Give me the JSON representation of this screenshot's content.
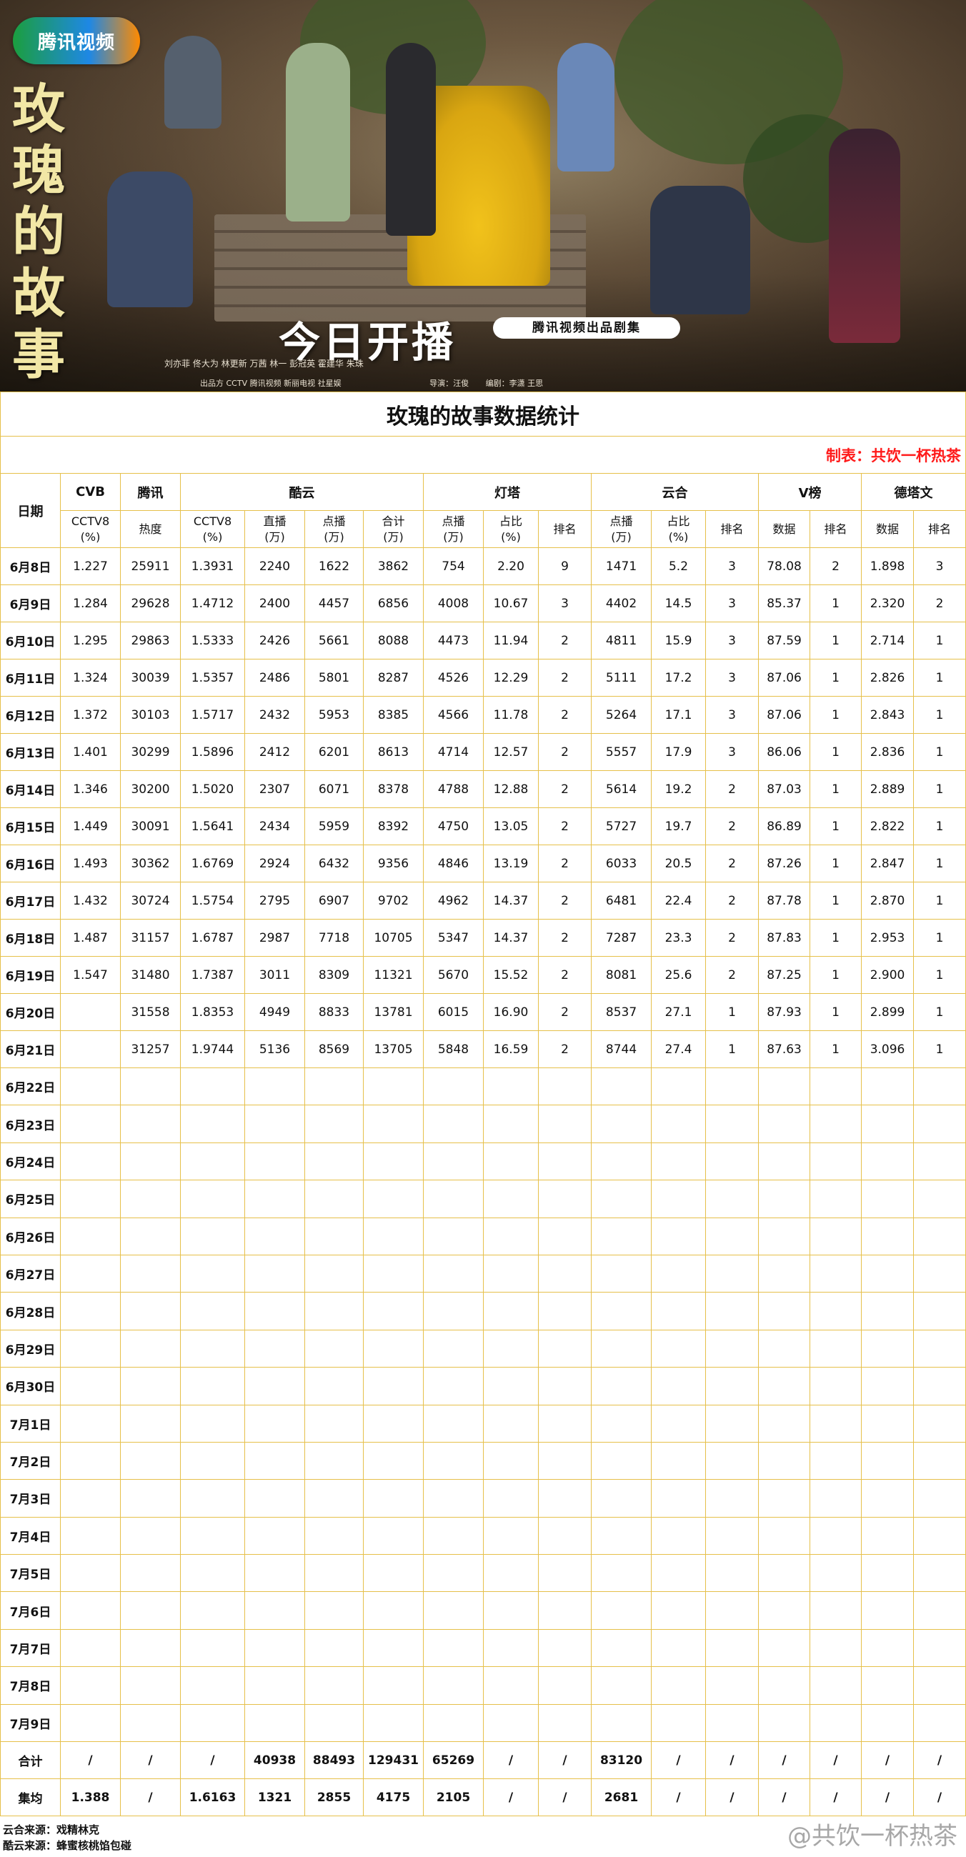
{
  "banner": {
    "logo_text": "腾讯视频",
    "show_title": [
      "玫",
      "瑰",
      "的",
      "故",
      "事"
    ],
    "premiere_text": "今日开播",
    "tag_text": "腾讯视频出品剧集",
    "credits": "刘亦菲   佟大为   林更新   万茜   林一   彭冠英   霍建华   朱珠",
    "producers": "出品方  CCTV  腾讯视频  新丽电视  社星娱",
    "director": "导演：汪俊",
    "writer": "编剧：李潇 王思"
  },
  "title": "玫瑰的故事数据统计",
  "author": "制表：共饮一杯热茶",
  "headers": {
    "date": "日期",
    "groups": [
      {
        "name": "CVB",
        "span": 1
      },
      {
        "name": "腾讯",
        "span": 1
      },
      {
        "name": "酷云",
        "span": 4
      },
      {
        "name": "灯塔",
        "span": 3
      },
      {
        "name": "云合",
        "span": 3
      },
      {
        "name": "V榜",
        "span": 2
      },
      {
        "name": "德塔文",
        "span": 2
      }
    ],
    "subs": [
      [
        "CCTV8",
        "(%)"
      ],
      [
        "热度"
      ],
      [
        "CCTV8",
        "(%)"
      ],
      [
        "直播",
        "(万)"
      ],
      [
        "点播",
        "(万)"
      ],
      [
        "合计",
        "(万)"
      ],
      [
        "点播",
        "(万)"
      ],
      [
        "占比",
        "(%)"
      ],
      [
        "排名"
      ],
      [
        "点播",
        "(万)"
      ],
      [
        "占比",
        "(%)"
      ],
      [
        "排名"
      ],
      [
        "数据"
      ],
      [
        "排名"
      ],
      [
        "数据"
      ],
      [
        "排名"
      ]
    ]
  },
  "rows": [
    {
      "date": "6月8日",
      "cells": [
        "1.227",
        "25911",
        "1.3931",
        "2240",
        "1622",
        "3862",
        "754",
        "2.20",
        "9",
        "1471",
        "5.2",
        "3",
        "78.08",
        "2",
        "1.898",
        "3"
      ]
    },
    {
      "date": "6月9日",
      "cells": [
        "1.284",
        "29628",
        "1.4712",
        "2400",
        "4457",
        "6856",
        "4008",
        "10.67",
        "3",
        "4402",
        "14.5",
        "3",
        "85.37",
        "1",
        "2.320",
        "2"
      ]
    },
    {
      "date": "6月10日",
      "cells": [
        "1.295",
        "29863",
        "1.5333",
        "2426",
        "5661",
        "8088",
        "4473",
        "11.94",
        "2",
        "4811",
        "15.9",
        "3",
        "87.59",
        "1",
        "2.714",
        "1"
      ]
    },
    {
      "date": "6月11日",
      "cells": [
        "1.324",
        "30039",
        "1.5357",
        "2486",
        "5801",
        "8287",
        "4526",
        "12.29",
        "2",
        "5111",
        "17.2",
        "3",
        "87.06",
        "1",
        "2.826",
        "1"
      ]
    },
    {
      "date": "6月12日",
      "cells": [
        "1.372",
        "30103",
        "1.5717",
        "2432",
        "5953",
        "8385",
        "4566",
        "11.78",
        "2",
        "5264",
        "17.1",
        "3",
        "87.06",
        "1",
        "2.843",
        "1"
      ]
    },
    {
      "date": "6月13日",
      "cells": [
        "1.401",
        "30299",
        "1.5896",
        "2412",
        "6201",
        "8613",
        "4714",
        "12.57",
        "2",
        "5557",
        "17.9",
        "3",
        "86.06",
        "1",
        "2.836",
        "1"
      ]
    },
    {
      "date": "6月14日",
      "cells": [
        "1.346",
        "30200",
        "1.5020",
        "2307",
        "6071",
        "8378",
        "4788",
        "12.88",
        "2",
        "5614",
        "19.2",
        "2",
        "87.03",
        "1",
        "2.889",
        "1"
      ]
    },
    {
      "date": "6月15日",
      "cells": [
        "1.449",
        "30091",
        "1.5641",
        "2434",
        "5959",
        "8392",
        "4750",
        "13.05",
        "2",
        "5727",
        "19.7",
        "2",
        "86.89",
        "1",
        "2.822",
        "1"
      ]
    },
    {
      "date": "6月16日",
      "cells": [
        "1.493",
        "30362",
        "1.6769",
        "2924",
        "6432",
        "9356",
        "4846",
        "13.19",
        "2",
        "6033",
        "20.5",
        "2",
        "87.26",
        "1",
        "2.847",
        "1"
      ]
    },
    {
      "date": "6月17日",
      "cells": [
        "1.432",
        "30724",
        "1.5754",
        "2795",
        "6907",
        "9702",
        "4962",
        "14.37",
        "2",
        "6481",
        "22.4",
        "2",
        "87.78",
        "1",
        "2.870",
        "1"
      ]
    },
    {
      "date": "6月18日",
      "cells": [
        "1.487",
        "31157",
        "1.6787",
        "2987",
        "7718",
        "10705",
        "5347",
        "14.37",
        "2",
        "7287",
        "23.3",
        "2",
        "87.83",
        "1",
        "2.953",
        "1"
      ]
    },
    {
      "date": "6月19日",
      "cells": [
        "1.547",
        "31480",
        "1.7387",
        "3011",
        "8309",
        "11321",
        "5670",
        "15.52",
        "2",
        "8081",
        "25.6",
        "2",
        "87.25",
        "1",
        "2.900",
        "1"
      ]
    },
    {
      "date": "6月20日",
      "cells": [
        "",
        "31558",
        "1.8353",
        "4949",
        "8833",
        "13781",
        "6015",
        "16.90",
        "2",
        "8537",
        "27.1",
        "1",
        "87.93",
        "1",
        "2.899",
        "1"
      ]
    },
    {
      "date": "6月21日",
      "cells": [
        "",
        "31257",
        "1.9744",
        "5136",
        "8569",
        "13705",
        "5848",
        "16.59",
        "2",
        "8744",
        "27.4",
        "1",
        "87.63",
        "1",
        "3.096",
        "1"
      ]
    },
    {
      "date": "6月22日",
      "cells": []
    },
    {
      "date": "6月23日",
      "cells": []
    },
    {
      "date": "6月24日",
      "cells": []
    },
    {
      "date": "6月25日",
      "cells": []
    },
    {
      "date": "6月26日",
      "cells": []
    },
    {
      "date": "6月27日",
      "cells": []
    },
    {
      "date": "6月28日",
      "cells": []
    },
    {
      "date": "6月29日",
      "cells": []
    },
    {
      "date": "6月30日",
      "cells": []
    },
    {
      "date": "7月1日",
      "cells": []
    },
    {
      "date": "7月2日",
      "cells": []
    },
    {
      "date": "7月3日",
      "cells": []
    },
    {
      "date": "7月4日",
      "cells": []
    },
    {
      "date": "7月5日",
      "cells": []
    },
    {
      "date": "7月6日",
      "cells": []
    },
    {
      "date": "7月7日",
      "cells": []
    },
    {
      "date": "7月8日",
      "cells": []
    },
    {
      "date": "7月9日",
      "cells": []
    }
  ],
  "summary": [
    {
      "label": "合计",
      "cells": [
        "/",
        "/",
        "/",
        "40938",
        "88493",
        "129431",
        "65269",
        "/",
        "/",
        "83120",
        "/",
        "/",
        "/",
        "/",
        "/",
        "/"
      ]
    },
    {
      "label": "集均",
      "cells": [
        "1.388",
        "/",
        "1.6163",
        "1321",
        "2855",
        "4175",
        "2105",
        "/",
        "/",
        "2681",
        "/",
        "/",
        "/",
        "/",
        "/",
        "/"
      ]
    }
  ],
  "footnotes": [
    "云合来源：戏精林克",
    "酷云来源：蜂蜜核桃馅包碰"
  ],
  "watermark": "@共饮一杯热茶",
  "colors": {
    "border": "#e6c04a",
    "author": "#ff1a1a"
  }
}
